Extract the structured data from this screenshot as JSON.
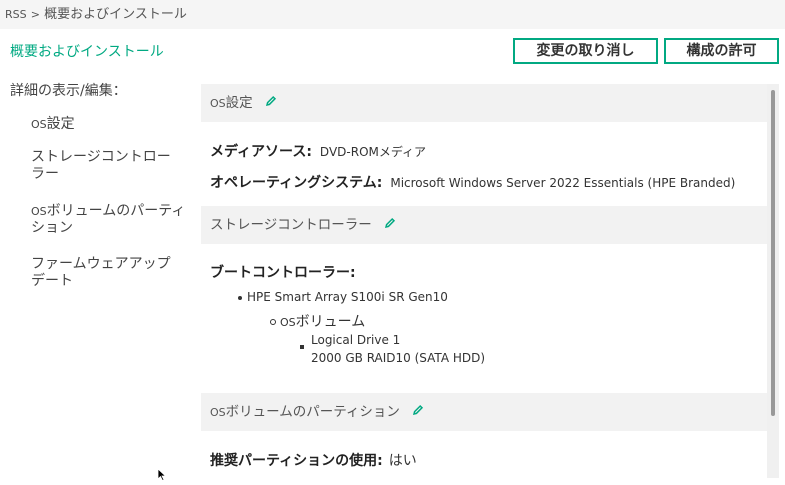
{
  "breadcrumb": {
    "root": "RSS",
    "sep": ">",
    "current": "概要およびインストール"
  },
  "page_title": "概要およびインストール",
  "buttons": {
    "cancel": "変更の取り消し",
    "commit": "構成の許可"
  },
  "sidebar": {
    "heading": "詳細の表示/編集：",
    "items": [
      {
        "prefix": "OS",
        "label": "設定"
      },
      {
        "prefix": "",
        "label": "ストレージコントローラー"
      },
      {
        "prefix": "OS",
        "label": "ボリュームのパーティション"
      },
      {
        "prefix": "",
        "label": "ファームウェアアップデート"
      }
    ]
  },
  "sections": {
    "os": {
      "title_prefix": "OS",
      "title": "設定",
      "media_label": "メディアソース:",
      "media_value": "DVD-ROMメディア",
      "os_label": "オペレーティングシステム:",
      "os_value": "Microsoft Windows Server 2022 Essentials (HPE Branded)"
    },
    "storage": {
      "title": "ストレージコントローラー",
      "boot_label": "ブートコントローラー:",
      "controller": "HPE Smart Array S100i SR Gen10",
      "volume_prefix": "OS",
      "volume_label": "ボリューム",
      "drive": "Logical Drive 1",
      "drive_detail": "2000 GB RAID10 (SATA HDD)"
    },
    "partition": {
      "title_prefix": "OS",
      "title": "ボリュームのパーティション",
      "recommended_label": "推奨パーティションの使用:",
      "recommended_value": "はい"
    }
  },
  "icons": {
    "edit": "pencil-icon",
    "cursor": "mouse-pointer-icon"
  },
  "colors": {
    "accent": "#01a982"
  }
}
